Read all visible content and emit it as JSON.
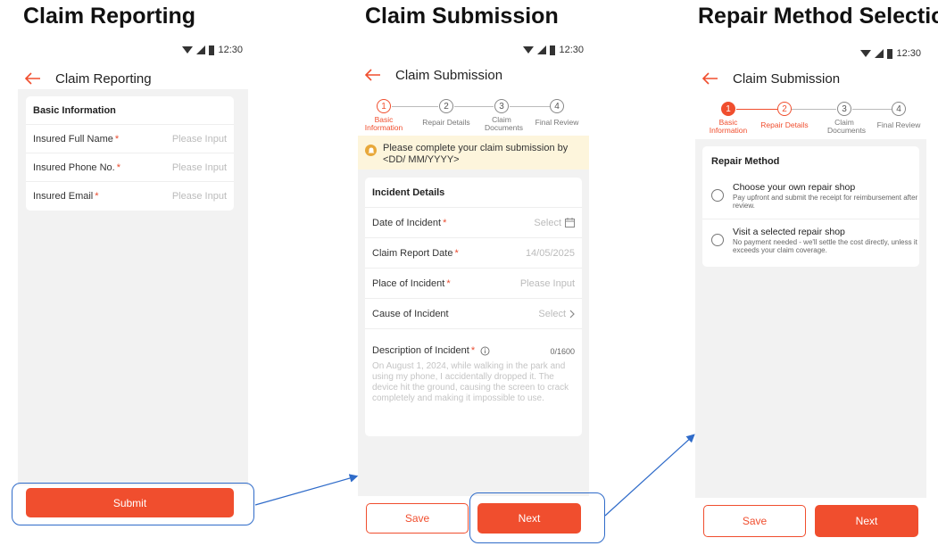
{
  "sections": {
    "reporting": "Claim Reporting",
    "submission": "Claim Submission",
    "repair": "Repair Method Selection"
  },
  "status": {
    "time": "12:30"
  },
  "screen1": {
    "header_title": "Claim Reporting",
    "card_title": "Basic Information",
    "fields": [
      {
        "label": "Insured Full Name",
        "placeholder": "Please Input"
      },
      {
        "label": "Insured Phone No.",
        "placeholder": "Please Input"
      },
      {
        "label": "Insured Email",
        "placeholder": "Please Input"
      }
    ],
    "required_mark": "*",
    "submit_label": "Submit"
  },
  "steps": [
    {
      "number": "1",
      "label": "Basic Information"
    },
    {
      "number": "2",
      "label": "Repair Details"
    },
    {
      "number": "3",
      "label": "Claim Documents"
    },
    {
      "number": "4",
      "label": "Final Review"
    }
  ],
  "screen2": {
    "header_title": "Claim Submission",
    "notice": "Please complete your claim submission by <DD/ MM/YYYY>",
    "card_title": "Incident Details",
    "fields": [
      {
        "label": "Date of Incident",
        "value": "Select"
      },
      {
        "label": "Claim Report Date",
        "value": "14/05/2025"
      },
      {
        "label": "Place of Incident",
        "value": "Please Input"
      },
      {
        "label": "Cause of Incident",
        "value": "Select"
      }
    ],
    "description_label": "Description of Incident",
    "description_counter": "0/1600",
    "description_placeholder": "On August 1, 2024, while walking in the park and using my phone, I accidentally dropped it. The device hit the ground, causing the screen to crack completely and making it impossible to use.",
    "save_label": "Save",
    "next_label": "Next"
  },
  "screen3": {
    "header_title": "Claim Submission",
    "card_title": "Repair Method",
    "options": [
      {
        "title": "Choose your own repair shop",
        "subtitle": "Pay upfront and submit the receipt for reimbursement after review."
      },
      {
        "title": "Visit a selected repair shop",
        "subtitle": "No payment needed - we'll settle the cost directly, unless it exceeds your claim coverage."
      }
    ],
    "save_label": "Save",
    "next_label": "Next"
  },
  "colors": {
    "accent": "#f04e2e",
    "highlight": "#2f6bc9",
    "notice_bg": "#fdf5dc"
  }
}
